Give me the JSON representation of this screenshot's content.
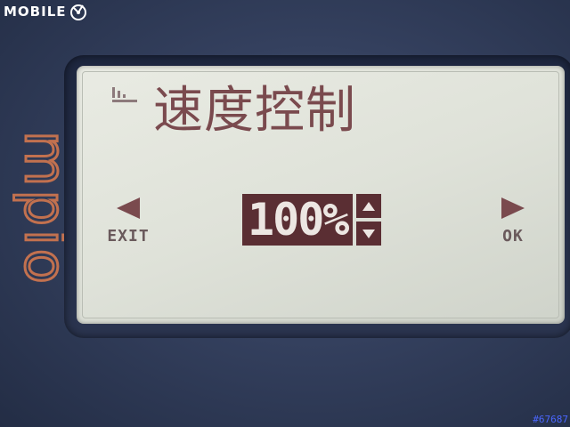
{
  "watermark": {
    "text": "MOBILE"
  },
  "device": {
    "brand": "mpio",
    "accent_color": "#c2714f"
  },
  "lcd": {
    "title": "速度控制",
    "signal_icon": "signal-strength-icon",
    "exit_label": "EXIT",
    "ok_label": "OK",
    "value": "100%",
    "text_color": "#7a4a4e",
    "highlight_color": "#5a2e33"
  },
  "corner_tag": {
    "text": "#67687"
  }
}
